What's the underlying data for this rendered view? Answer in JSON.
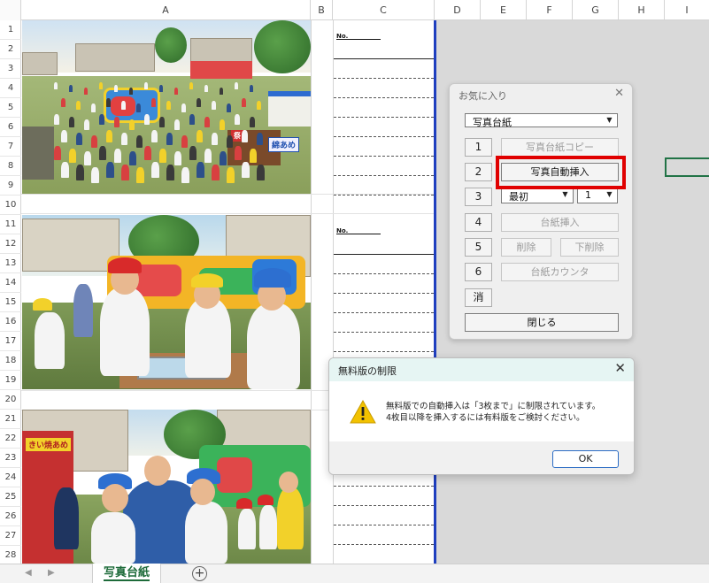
{
  "column_headers": [
    "A",
    "B",
    "C",
    "D",
    "E",
    "F",
    "G",
    "H",
    "I"
  ],
  "row_headers": [
    "1",
    "2",
    "3",
    "4",
    "5",
    "6",
    "7",
    "8",
    "9",
    "10",
    "11",
    "12",
    "13",
    "14",
    "15",
    "16",
    "17",
    "18",
    "19",
    "20",
    "21",
    "22",
    "23",
    "24",
    "25",
    "26",
    "27",
    "28"
  ],
  "sheet": {
    "no_label": "No.",
    "tab_label": "写真台紙",
    "add_sheet_icon": "plus-circle-icon",
    "photos": [
      {
        "banner": "",
        "sign": "綿あめ"
      },
      {
        "banner": "",
        "sign": ""
      },
      {
        "banner": "きい焼あめ",
        "sign": ""
      }
    ]
  },
  "favorites_dialog": {
    "title": "お気に入り",
    "close": "✕",
    "template_select": "写真台紙",
    "buttons": [
      {
        "number": "1",
        "label": "写真台紙コピー"
      },
      {
        "number": "2",
        "label": "写真自動挿入"
      },
      {
        "number": "3",
        "position_select": "最初",
        "count_select": "1"
      },
      {
        "number": "4",
        "label": "台紙挿入"
      },
      {
        "number": "5",
        "label_a": "削除",
        "label_b": "下削除"
      },
      {
        "number": "6",
        "label": "台紙カウンタ"
      }
    ],
    "erase_button": "消",
    "close_button": "閉じる"
  },
  "limit_dialog": {
    "title": "無料版の制限",
    "close": "✕",
    "message_line1": "無料版での自動挿入は「3枚まで」に制限されています。",
    "message_line2": "4枚目以降を挿入するには有料版をご検討ください。",
    "ok_button": "OK"
  },
  "colors": {
    "highlight": "#e00000",
    "selection": "#217346",
    "print_border": "#1f3fbf",
    "dialog_header": "#e6f5f3"
  }
}
